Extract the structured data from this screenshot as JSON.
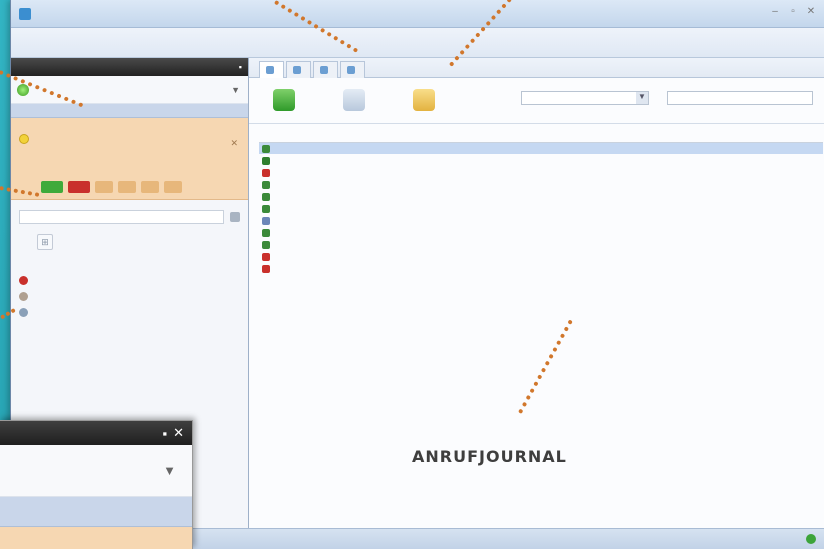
{
  "window": {
    "title": "",
    "controls": [
      "–",
      "▫",
      "✕"
    ]
  },
  "menu": [
    "",
    "",
    "",
    "",
    ""
  ],
  "left": {
    "panel_header": "",
    "status_label": "",
    "line_label": "",
    "call": {
      "number": "",
      "name": "",
      "state": "",
      "info": ""
    },
    "search_placeholder": "",
    "links": [
      {
        "text": "",
        "color": "#c9302c"
      },
      {
        "text": "",
        "color": "#b0a090"
      },
      {
        "text": "",
        "color": "#8aa0b8"
      }
    ]
  },
  "tabs": [
    {
      "label": ""
    },
    {
      "label": ""
    },
    {
      "label": ""
    },
    {
      "label": ""
    }
  ],
  "toolbar": {
    "call_label": "",
    "contact_label": "",
    "open_label": "",
    "filter_value": "",
    "search_placeholder": ""
  },
  "journal": {
    "columns": [
      "",
      "",
      "",
      "",
      ""
    ],
    "rows": [
      {
        "name": "",
        "number": "",
        "date": "",
        "duration": "",
        "for": "",
        "icon_color": "#3b8a3a",
        "selected": true
      },
      {
        "name": "",
        "number": "",
        "date": "",
        "duration": "",
        "for": "",
        "icon_color": "#2f7f2f",
        "selected": false
      },
      {
        "name": "",
        "number": "",
        "date": "",
        "duration": "",
        "for": "",
        "icon_color": "#c9302c",
        "selected": false
      },
      {
        "name": "",
        "number": "",
        "date": "",
        "duration": "",
        "for": "",
        "icon_color": "#3b8a3a",
        "selected": false
      },
      {
        "name": "",
        "number": "",
        "date": "",
        "duration": "",
        "for": "",
        "icon_color": "#3b8a3a",
        "selected": false
      },
      {
        "name": "",
        "number": "",
        "date": "",
        "duration": "",
        "for": "",
        "icon_color": "#3b8a3a",
        "selected": false
      },
      {
        "name": "",
        "number": "",
        "date": "",
        "duration": "",
        "for": "",
        "icon_color": "#6b86b8",
        "selected": false
      },
      {
        "name": "",
        "number": "",
        "date": "",
        "duration": "",
        "for": "",
        "icon_color": "#3b8a3a",
        "selected": false
      },
      {
        "name": "",
        "number": "",
        "date": "",
        "duration": "",
        "for": "",
        "icon_color": "#3b8a3a",
        "selected": false
      },
      {
        "name": "",
        "number": "",
        "date": "",
        "duration": "",
        "for": "",
        "icon_color": "#c9302c",
        "selected": false
      },
      {
        "name": "",
        "number": "",
        "date": "",
        "duration": "",
        "for": "",
        "icon_color": "#c9302c",
        "selected": false
      }
    ]
  },
  "statusbar": {
    "right_text": ""
  },
  "annotation": {
    "label": "ANRUFJOURNAL"
  },
  "colors": {
    "accent_orange": "#d1772c",
    "background_teal": "#2aa4b3",
    "selection": "#c5d8f2"
  }
}
